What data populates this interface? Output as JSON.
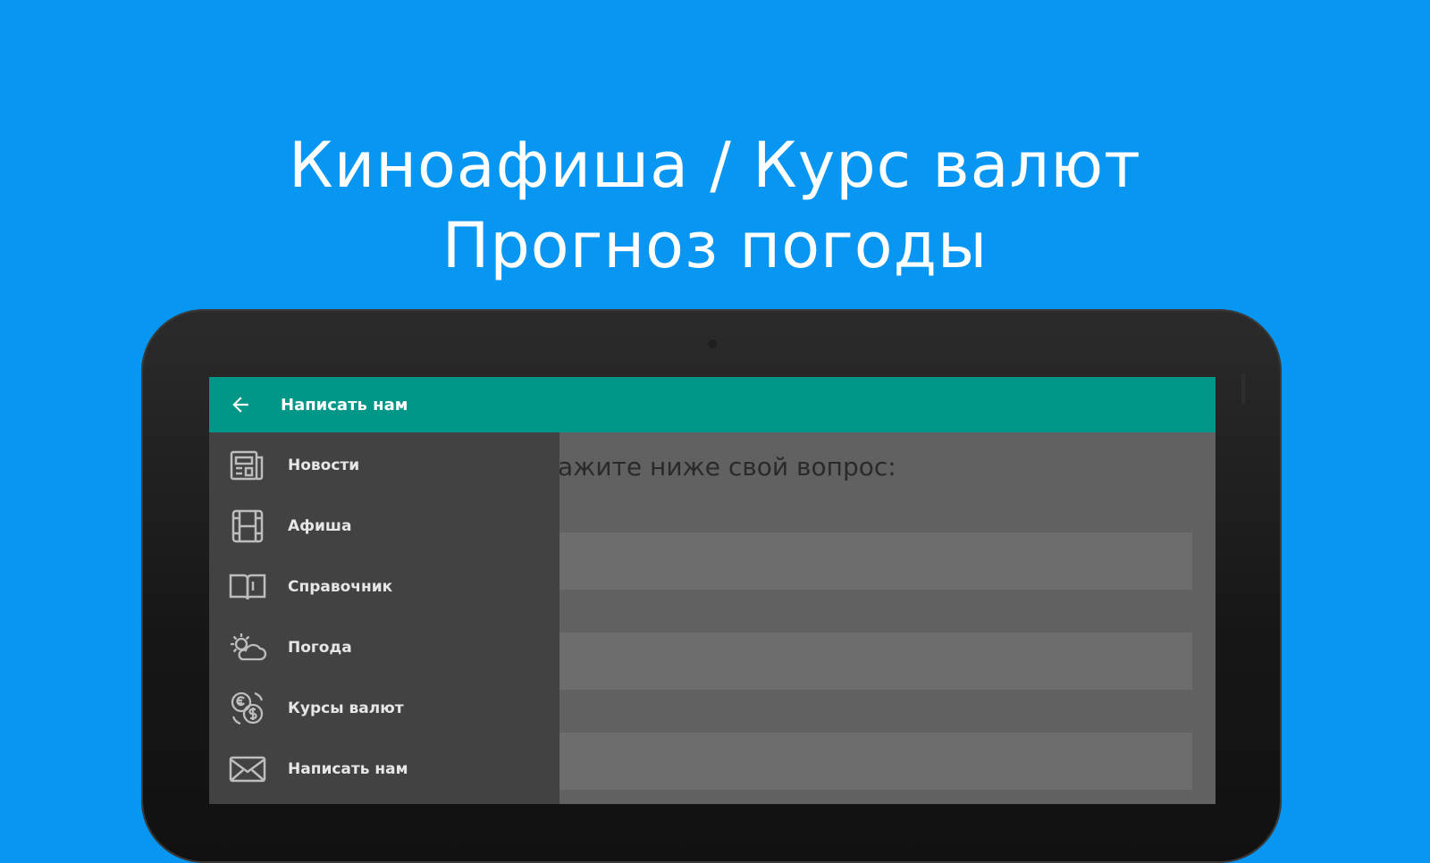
{
  "headline": {
    "line1": "Киноафиша / Курс валют",
    "line2": "Прогноз погоды"
  },
  "app": {
    "toolbar": {
      "title": "Написать нам",
      "back_icon": "arrow-left-icon"
    },
    "drawer": {
      "items": [
        {
          "label": "Новости",
          "icon": "newspaper-icon"
        },
        {
          "label": "Афиша",
          "icon": "film-icon"
        },
        {
          "label": "Справочник",
          "icon": "book-icon"
        },
        {
          "label": "Погода",
          "icon": "weather-icon"
        },
        {
          "label": "Курсы валют",
          "icon": "currency-icon"
        },
        {
          "label": "Написать нам",
          "icon": "mail-icon"
        }
      ]
    },
    "form": {
      "prompt": "ажите ниже свой вопрос:",
      "fields": [
        "",
        "",
        ""
      ]
    }
  },
  "colors": {
    "background": "#0796f2",
    "toolbar": "#009688",
    "drawer": "#424242",
    "content": "#616161"
  }
}
